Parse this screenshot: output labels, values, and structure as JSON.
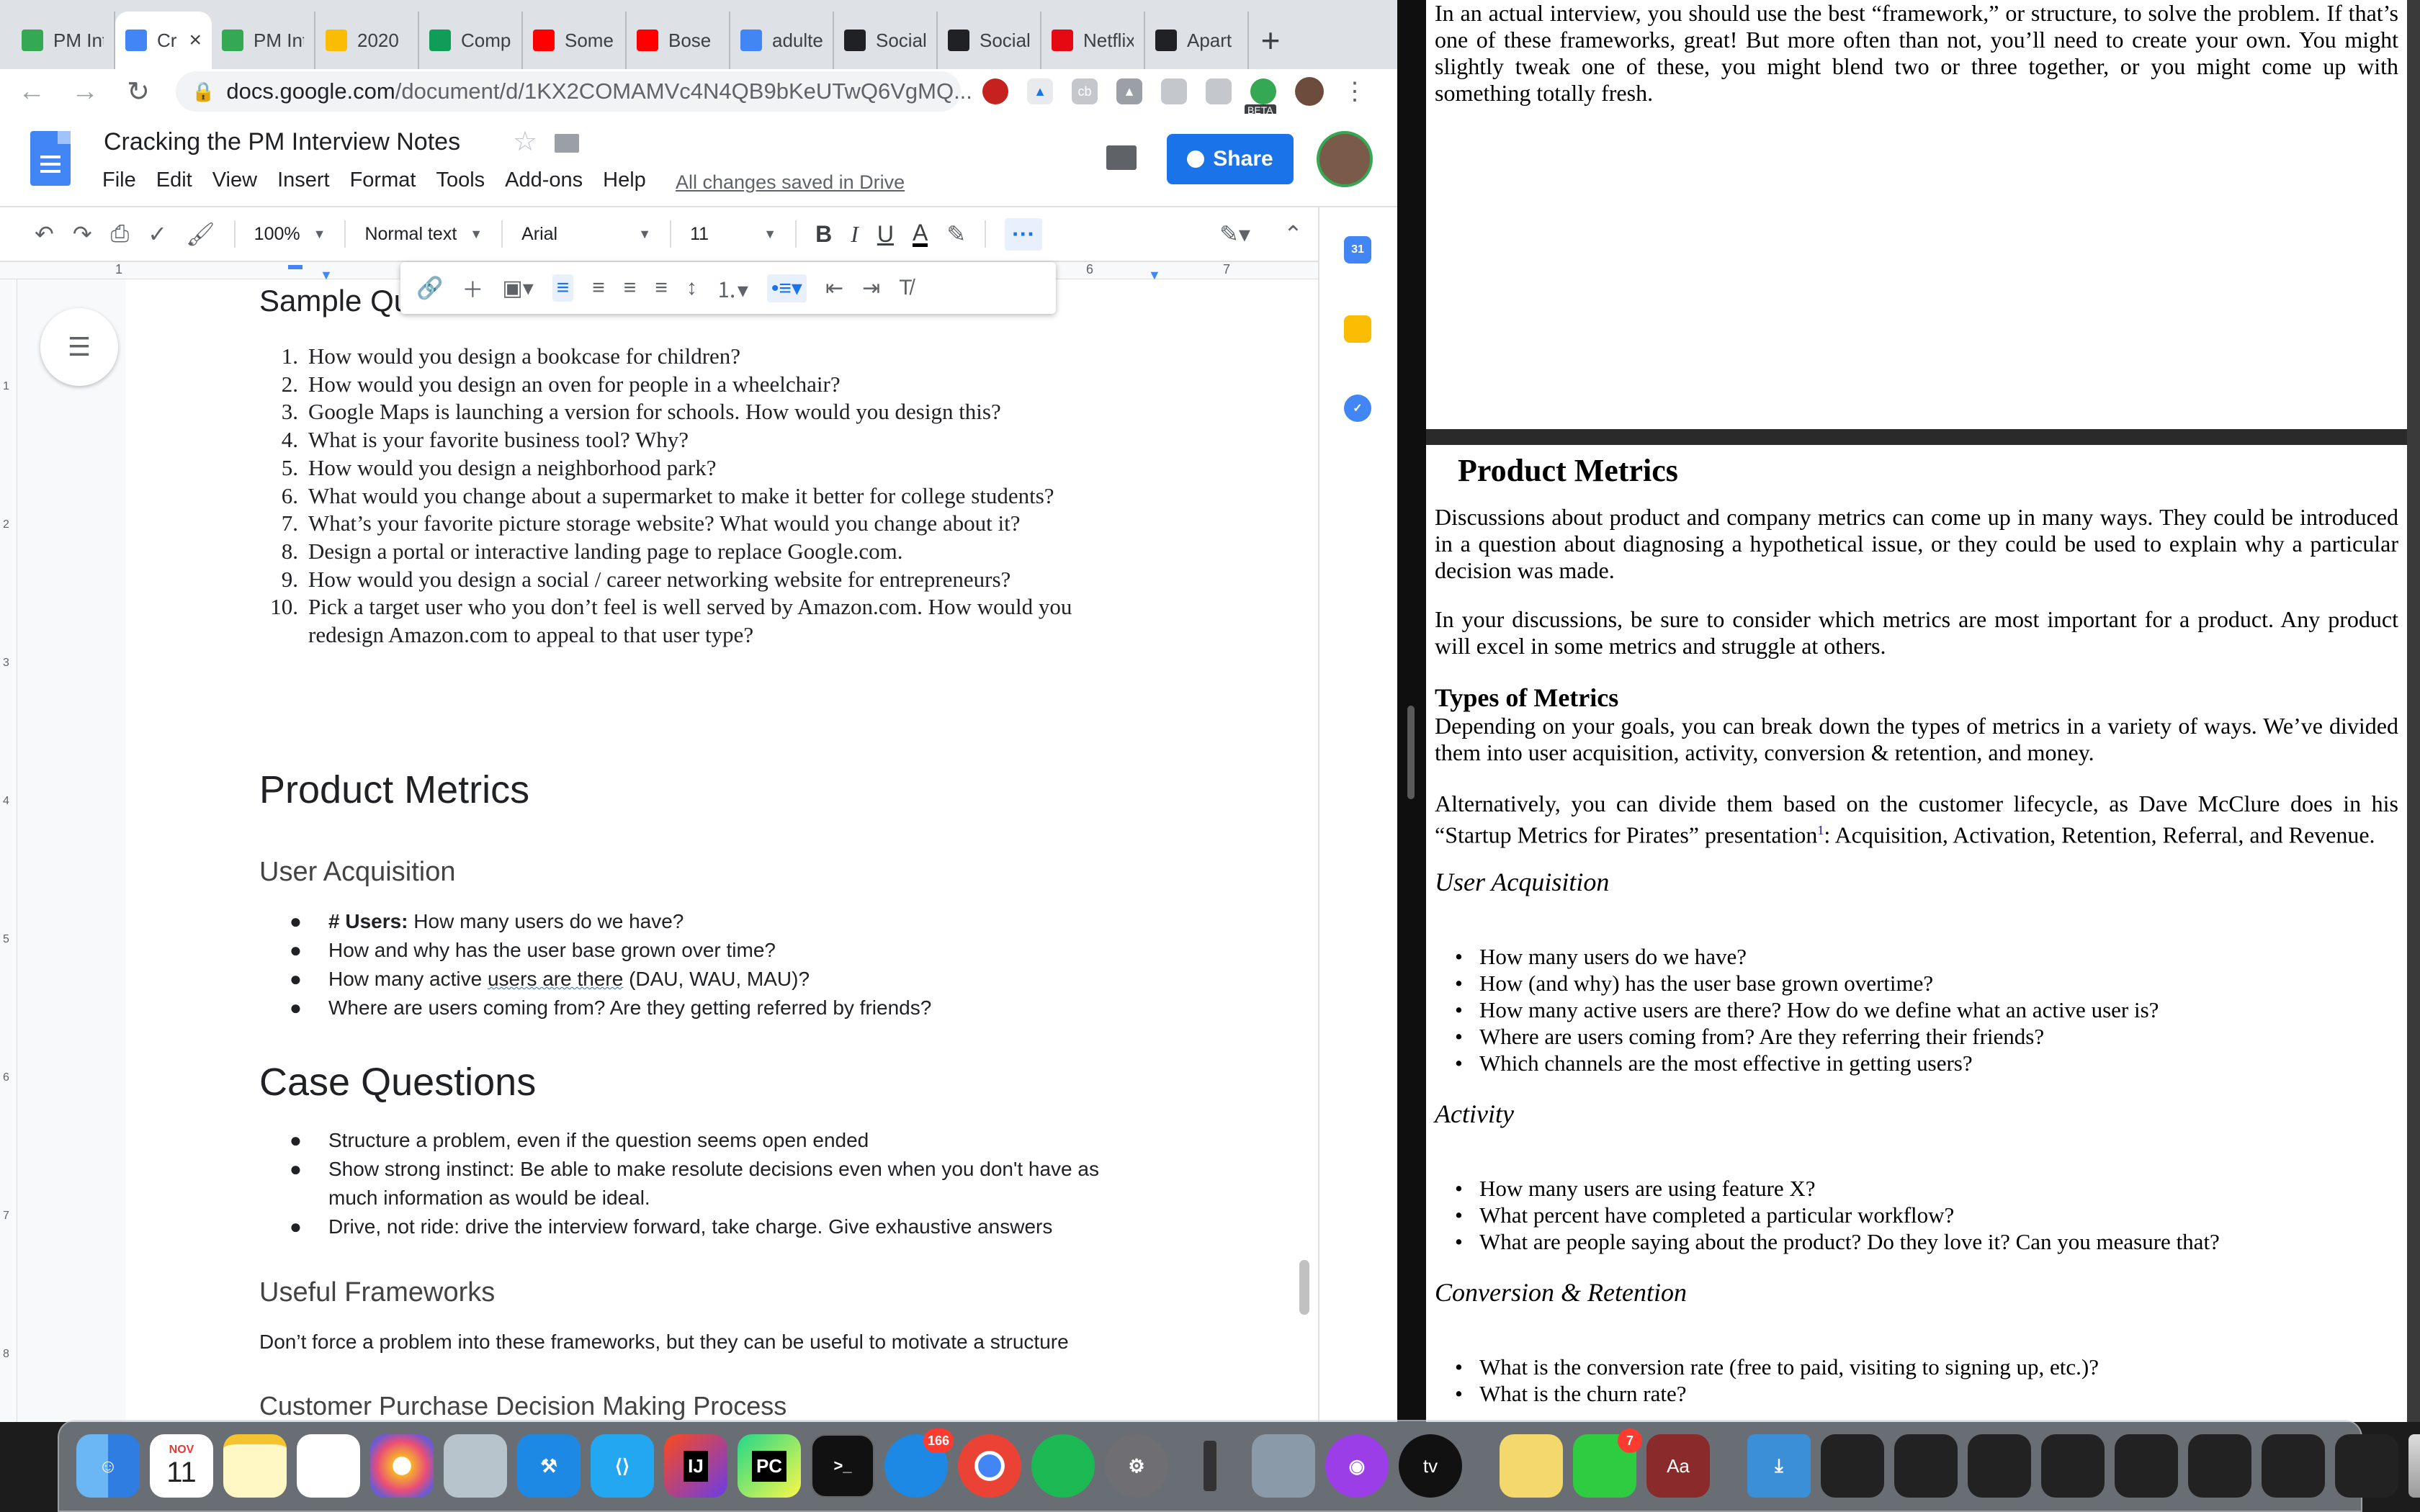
{
  "browser": {
    "tabs": [
      {
        "label": "PM Int",
        "icon": "drive-icon",
        "color": "#34a853",
        "active": false
      },
      {
        "label": "Cr",
        "icon": "docs-icon",
        "color": "#4285f4",
        "active": true
      },
      {
        "label": "PM Int",
        "icon": "drive-icon",
        "color": "#34a853",
        "active": false
      },
      {
        "label": "2020",
        "icon": "drive-icon",
        "color": "#fbbc04",
        "active": false
      },
      {
        "label": "Comp",
        "icon": "sheets-icon",
        "color": "#0f9d58",
        "active": false
      },
      {
        "label": "Some",
        "icon": "youtube-icon",
        "color": "#ff0000",
        "active": false
      },
      {
        "label": "Bose",
        "icon": "youtube-icon",
        "color": "#ff0000",
        "active": false
      },
      {
        "label": "adulte",
        "icon": "google-icon",
        "color": "#4285f4",
        "active": false
      },
      {
        "label": "Social",
        "icon": "openai-icon",
        "color": "#202124",
        "active": false
      },
      {
        "label": "Social",
        "icon": "openai-icon",
        "color": "#202124",
        "active": false
      },
      {
        "label": "Netflix",
        "icon": "netflix-icon",
        "color": "#e50914",
        "active": false
      },
      {
        "label": "Apart",
        "icon": "medium-icon",
        "color": "#202124",
        "active": false
      }
    ],
    "close_glyph": "×",
    "new_tab_glyph": "+",
    "url_host": "docs.google.com",
    "url_path": "/document/d/1KX2COMAMVc4N4QB9bKeUTwQ6VgMQ...",
    "beta_label": "BETA"
  },
  "docs": {
    "title": "Cracking the PM Interview Notes",
    "menu": [
      "File",
      "Edit",
      "View",
      "Insert",
      "Format",
      "Tools",
      "Add-ons",
      "Help"
    ],
    "saved_status": "All changes saved in Drive",
    "share_label": "Share",
    "zoom": "100%",
    "style": "Normal text",
    "font": "Arial",
    "font_size": "11",
    "ruler_marks": [
      "1",
      "6",
      "7"
    ],
    "vruler_marks": [
      "1",
      "2",
      "3",
      "4",
      "5",
      "6",
      "7",
      "8"
    ],
    "calendar_day": "31"
  },
  "doc": {
    "sample_heading": "Sample Qu",
    "sample_questions": [
      "How would you design a bookcase for children?",
      "How would you design an oven for people in a wheelchair?",
      "Google Maps is launching a version for schools. How would you design this?",
      "What is your favorite business tool? Why?",
      "How would you design a neighborhood park?",
      "What would you change about a supermarket to make it better for college students?",
      "What’s your favorite picture storage website? What would you change about it?",
      "Design a portal or interactive landing page to replace Google.com.",
      "How would you design a social / career networking website for entrepreneurs?",
      "Pick a target user who you don’t feel is well served by Amazon.com. How would you redesign Amazon.com to appeal to that user type?"
    ],
    "product_metrics_heading": "Product Metrics",
    "user_acq_heading": "User Acquisition",
    "user_acq_first_bold": "# Users:",
    "user_acq_first_rest": " How many users do we have?",
    "user_acq_items": [
      "How and why has the user base grown over time?",
      "Where are users coming from? Are they getting referred by friends?"
    ],
    "active_users": {
      "pre": "How many active ",
      "underlined": "users are there",
      "post": " (DAU, WAU, MAU)?"
    },
    "case_heading": "Case Questions",
    "case_items": [
      "Structure a problem, even if the question seems open ended",
      "Show strong instinct: Be able to make resolute decisions even when you don't have as much information as would be ideal.",
      "Drive, not ride: drive the interview forward, take charge. Give exhaustive answers"
    ],
    "frameworks_heading": "Useful Frameworks",
    "frameworks_text": "Don’t force a problem into these frameworks, but they can be useful to motivate a structure",
    "cpdm_heading": "Customer Purchase Decision Making Process"
  },
  "pdf": {
    "top_para": "In an actual interview, you should use the best “framework,” or structure, to solve the problem. If that’s one of these frameworks, great! But more often than not, you’ll need to create your own. You might slightly tweak one of these, you might blend two or three together, or you might come up with something totally fresh.",
    "heading": "Product Metrics",
    "para1": "Discussions about product and company metrics can come up in many ways. They could be introduced in a question about diagnosing a hypothetical issue, or they could be used to explain why a particular decision was made.",
    "para2": "In your discussions, be sure to consider which metrics are most important for a product. Any product will excel in some metrics and struggle at others.",
    "types_heading": "Types of Metrics",
    "para3": "Depending on your goals, you can break down the types of metrics in a variety of ways. We’ve divided them into user acquisition, activity, conversion & retention, and money.",
    "para4_pre": "Alternatively, you can divide them based on the customer lifecycle, as Dave McClure does in his “Startup Metrics for Pirates” presentation",
    "para4_fn": "1",
    "para4_post": ": Acquisition, Activation, Retention, Referral, and Revenue.",
    "ua_heading": "User Acquisition",
    "ua_items": [
      "How many users do we have?",
      "How (and why) has the user base grown overtime?",
      "How many active users are there? How do we define what an active user is?",
      "Where are users coming from? Are they referring their friends?",
      "Which channels are the most effective in getting users?"
    ],
    "activity_heading": "Activity",
    "activity_items": [
      "How many users are using feature X?",
      "What percent have completed a particular workflow?",
      "What are people saying about the product? Do they love it? Can you measure that?"
    ],
    "conv_heading": "Conversion & Retention",
    "conv_items": [
      "What is the conversion rate (free to paid, visiting to signing up, etc.)?",
      "What is the churn rate?"
    ]
  },
  "dock": {
    "calendar_month": "NOV",
    "calendar_day": "11",
    "messages_badge": "166",
    "facetime_badge": "7",
    "tv_label": "tv",
    "ij_label": "IJ",
    "pc_label": "PC",
    "dict_label": "Aa"
  }
}
